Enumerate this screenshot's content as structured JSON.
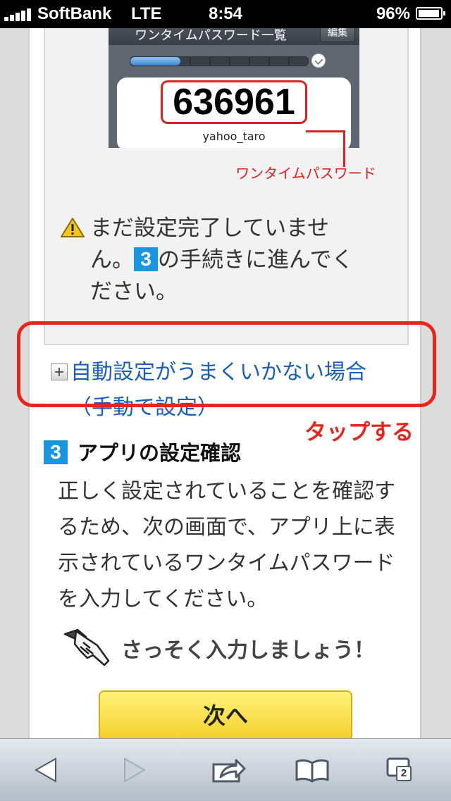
{
  "status_bar": {
    "carrier": "SoftBank",
    "network": "LTE",
    "time": "8:54",
    "battery": "96%",
    "battery_level": 0.96,
    "signal_bars": 5
  },
  "app_screenshot": {
    "nav_title": "ワンタイムパスワード一覧",
    "edit_button": "編集",
    "password": "636961",
    "username": "yahoo_taro",
    "callout_label": "ワンタイムパスワード",
    "progress_level": 0.28
  },
  "warning": {
    "icon": "warning-icon",
    "text_before": "まだ設定完了していません。",
    "step_number": "3",
    "text_after": "の手続きに進んでください。"
  },
  "manual_setup": {
    "icon": "plus-expand-icon",
    "line1": "自動設定がうまくいかない場合",
    "line2": "（手動で設定）"
  },
  "annotation": {
    "tap_label": "タップする",
    "color": "#e8241b"
  },
  "step3": {
    "number": "3",
    "title": "アプリの設定確認",
    "body": "正しく設定されていることを確認するため、次の画面で、アプリ上に表示されているワンタイムパスワードを入力してください。",
    "prompt": "さっそく入力しましょう！",
    "next_button": "次へ"
  },
  "toolbar": {
    "back_icon": "back-arrow-icon",
    "forward_icon": "forward-arrow-icon",
    "share_icon": "share-icon",
    "bookmarks_icon": "bookmarks-book-icon",
    "tabs_icon": "tabs-icon",
    "tabs_count": "2"
  }
}
